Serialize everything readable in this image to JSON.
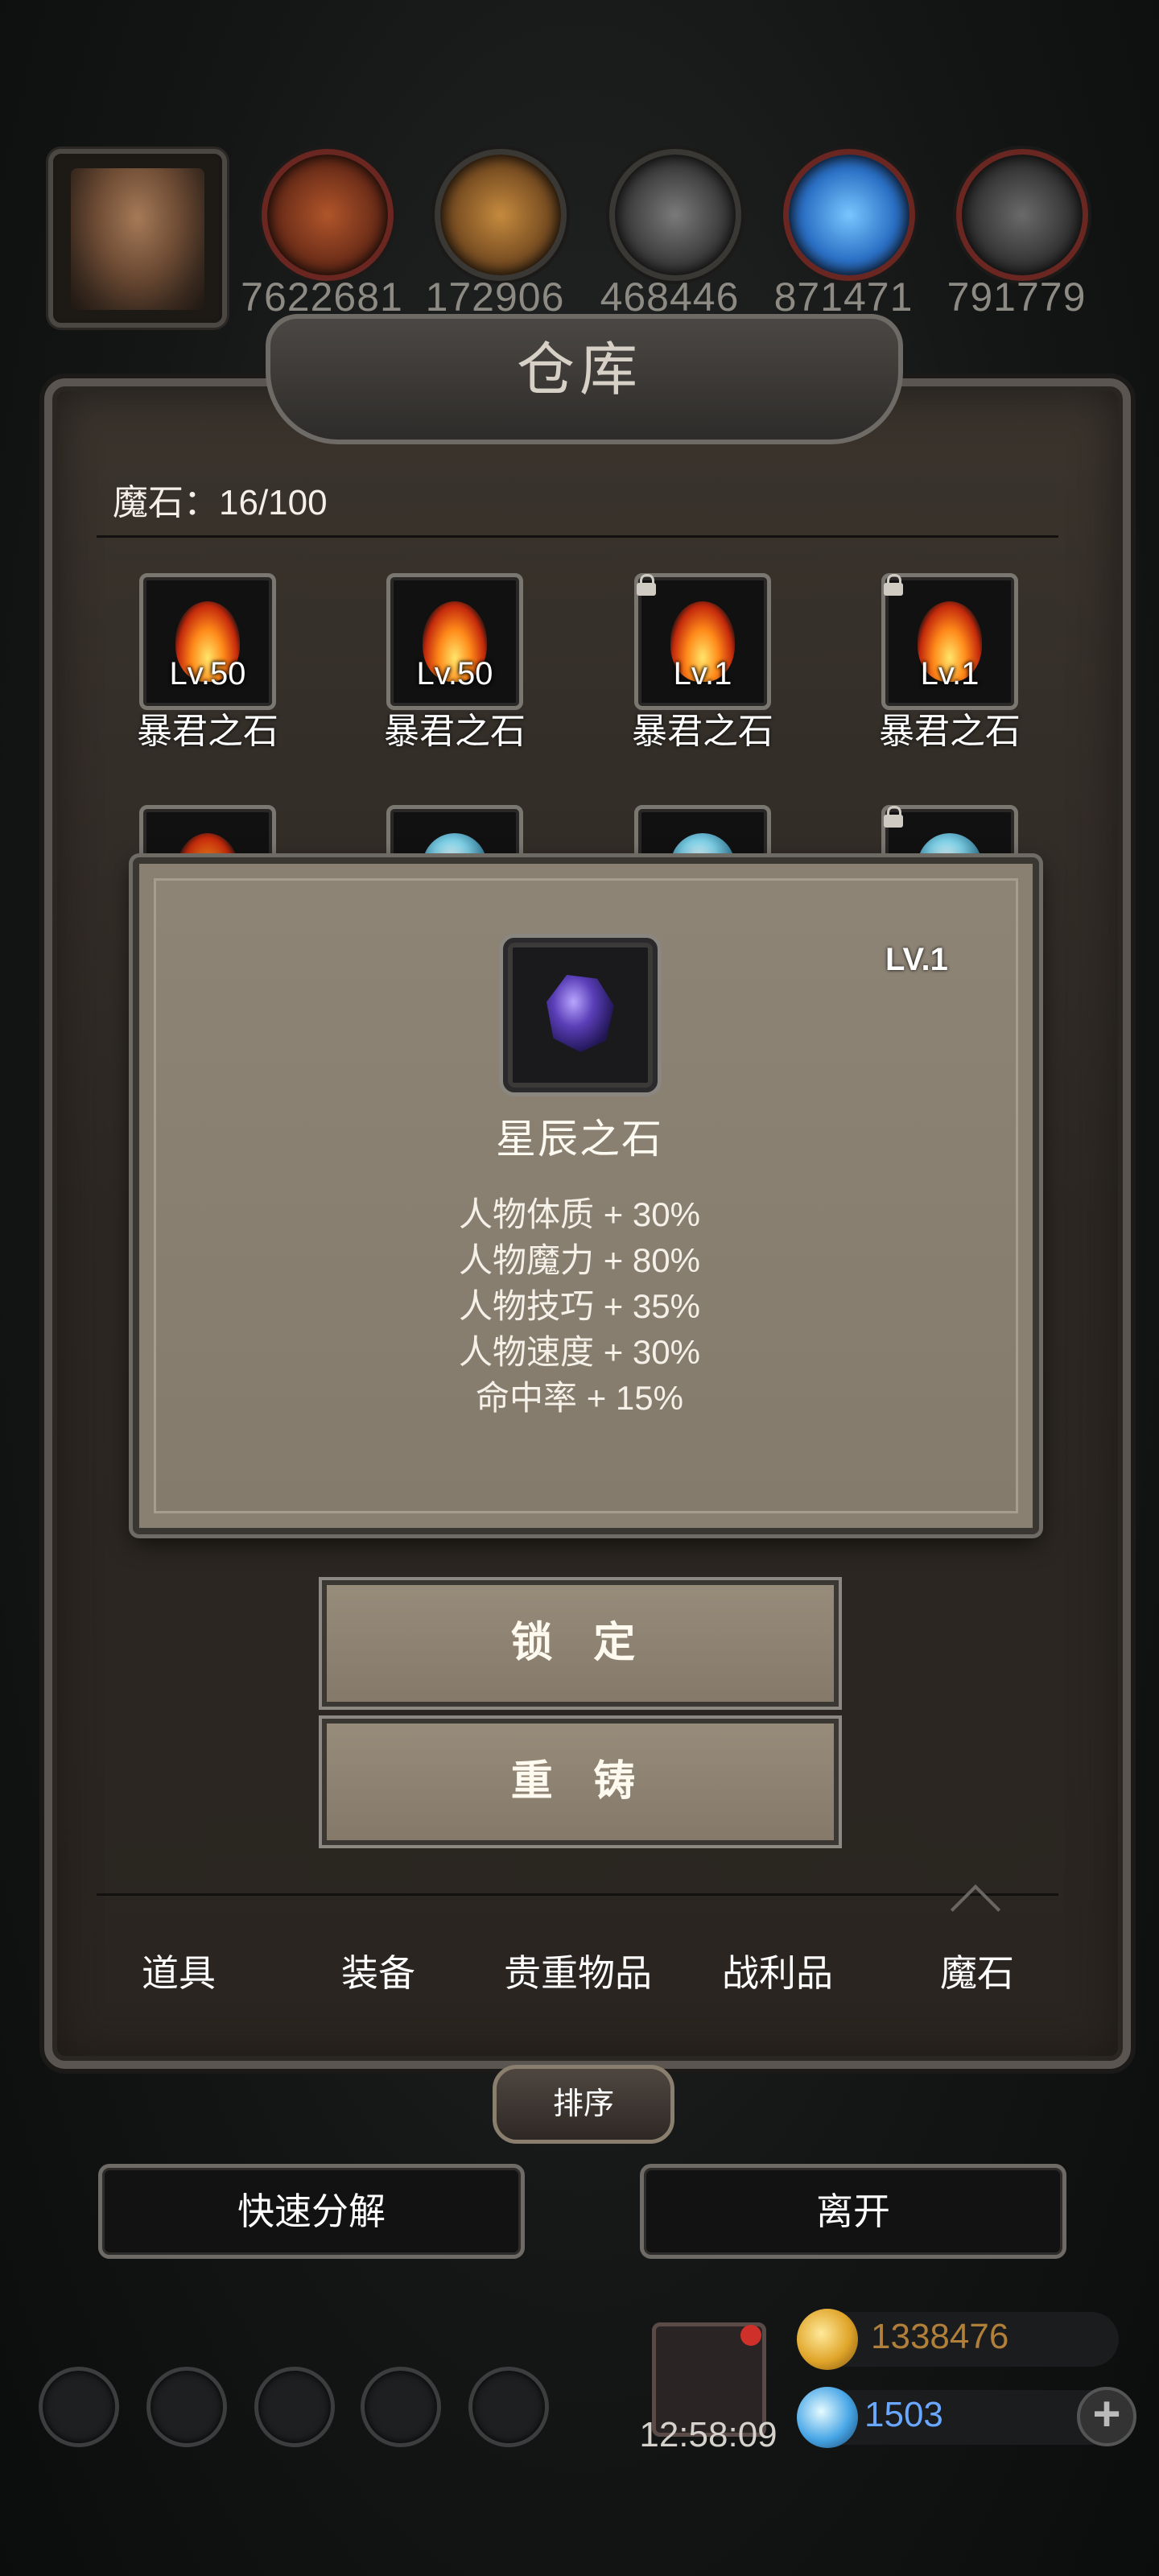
{
  "resources": [
    {
      "value": "7622681",
      "icon": "meat-icon",
      "color": "#b0352a"
    },
    {
      "value": "172906",
      "icon": "wood-icon",
      "color": "#3a3835"
    },
    {
      "value": "468446",
      "icon": "iron-icon",
      "color": "#3a3835"
    },
    {
      "value": "871471",
      "icon": "crystal-icon",
      "color": "#b0352a"
    },
    {
      "value": "791779",
      "icon": "stone-icon",
      "color": "#b0352a"
    }
  ],
  "panel": {
    "title": "仓库",
    "count_label": "魔石：16/100"
  },
  "items_row1": [
    {
      "level": "Lv.50",
      "name": "暴君之石",
      "locked": false
    },
    {
      "level": "Lv.50",
      "name": "暴君之石",
      "locked": false
    },
    {
      "level": "Lv.1",
      "name": "暴君之石",
      "locked": true
    },
    {
      "level": "Lv.1",
      "name": "暴君之石",
      "locked": true
    }
  ],
  "popup": {
    "level": "LV.1",
    "name": "星辰之石",
    "stats": [
      "人物体质 + 30%",
      "人物魔力 + 80%",
      "人物技巧 + 35%",
      "人物速度 + 30%",
      "命中率 + 15%"
    ]
  },
  "actions": {
    "lock": "锁 定",
    "recast": "重 铸"
  },
  "tabs": [
    "道具",
    "装备",
    "贵重物品",
    "战利品",
    "魔石"
  ],
  "active_tab": "魔石",
  "sort_label": "排序",
  "bottom": {
    "quick_decompose": "快速分解",
    "leave": "离开"
  },
  "hud": {
    "timer": "12:58:09",
    "gold": "1338476",
    "gems": "1503",
    "plus": "+"
  }
}
